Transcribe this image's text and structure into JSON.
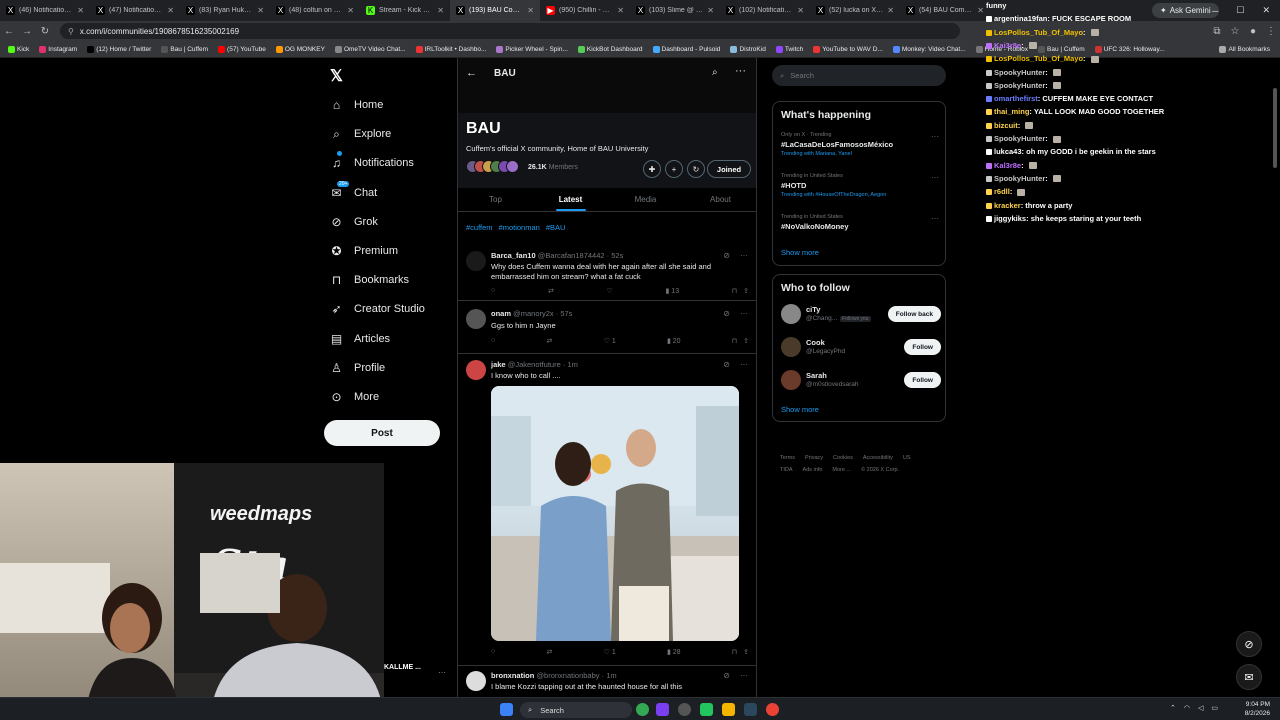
{
  "browser": {
    "tabs": [
      {
        "title": "(46) Notifications / X",
        "icon": "x-icon",
        "active": false
      },
      {
        "title": "(47) Notifications / X",
        "icon": "x-icon",
        "active": false
      },
      {
        "title": "(83) Ryan Hukery on",
        "icon": "x-icon",
        "active": false
      },
      {
        "title": "(48) coltun on X: \"ht",
        "icon": "x-icon",
        "active": false
      },
      {
        "title": "Stream - Kick Dashb",
        "icon": "kick-icon",
        "active": false
      },
      {
        "title": "(193) BAU Communi",
        "icon": "x-icon",
        "active": true
      },
      {
        "title": "(950) Chillin - YouTu",
        "icon": "youtube-icon",
        "active": false
      },
      {
        "title": "(103) Slime @ on X",
        "icon": "x-icon",
        "active": false
      },
      {
        "title": "(102) Notifications /",
        "icon": "x-icon",
        "active": false
      },
      {
        "title": "(52) lucka on X: \"htt",
        "icon": "x-icon",
        "active": false
      },
      {
        "title": "(54) BAU Commun",
        "icon": "x-icon",
        "active": false
      }
    ],
    "ask_gemini": "Ask Gemini",
    "url": "x.com/i/communities/1908678516235002169",
    "bookmarks": [
      "Kick",
      "Instagram",
      "(12) Home / Twitter",
      "Bau | Cuffem",
      "(57) YouTube",
      "OG MONKEY",
      "OmeTV Video Chat...",
      "IRLToolkit • Dashbo...",
      "Picker Wheel - Spin...",
      "KickBot Dashboard",
      "Dashboard - Pulsoid",
      "DistroKid",
      "Twitch",
      "YouTube to WAV D...",
      "Monkey: Video Chat...",
      "Home - Roblox",
      "Bau | Cuffem",
      "UFC 326: Holloway..."
    ],
    "all_bookmarks": "All Bookmarks"
  },
  "left_nav": {
    "items": [
      {
        "label": "Home",
        "icon": "home-icon"
      },
      {
        "label": "Explore",
        "icon": "search-icon"
      },
      {
        "label": "Notifications",
        "icon": "bell-icon"
      },
      {
        "label": "Chat",
        "icon": "chat-icon",
        "badge": "20+"
      },
      {
        "label": "Grok",
        "icon": "grok-icon"
      },
      {
        "label": "Premium",
        "icon": "premium-icon"
      },
      {
        "label": "Bookmarks",
        "icon": "bookmark-icon"
      },
      {
        "label": "Creator Studio",
        "icon": "rocket-icon"
      },
      {
        "label": "Articles",
        "icon": "article-icon"
      },
      {
        "label": "Profile",
        "icon": "profile-icon"
      },
      {
        "label": "More",
        "icon": "more-icon"
      }
    ],
    "post_button": "Post"
  },
  "community": {
    "header_title": "BAU",
    "title": "BAU",
    "description": "Cuffem's official X community, Home of BAU University",
    "members_count": "26.1K",
    "members_label": "Members",
    "joined_label": "Joined",
    "tabs": [
      "Top",
      "Latest",
      "Media",
      "About"
    ],
    "active_tab": "Latest",
    "tags": [
      "#cuffem",
      "#motionman",
      "#BAU"
    ]
  },
  "tweets": [
    {
      "name": "Barca_fan10",
      "handle": "@Barcafan1874442",
      "time": "52s",
      "text": "Why does Cuffem wanna deal with her again after all she said and embarrassed him on stream? what a fat cuck",
      "replies": "",
      "retweets": "",
      "likes": "",
      "views": "13"
    },
    {
      "name": "onam",
      "handle": "@manory2x",
      "time": "57s",
      "text": "Ggs to him n Jayne",
      "replies": "",
      "retweets": "",
      "likes": "1",
      "views": "20"
    },
    {
      "name": "jake",
      "handle": "@Jakenotfuture",
      "time": "1m",
      "text": "I know who to call ....",
      "replies": "",
      "retweets": "",
      "likes": "1",
      "views": "28"
    },
    {
      "name": "bronxnation",
      "handle": "@bronxnationbaby",
      "time": "1m",
      "text": "I blame Kozzi tapping out at the haunted house for all this",
      "replies": "",
      "retweets": "",
      "likes": "",
      "views": ""
    }
  ],
  "right": {
    "search_placeholder": "Search",
    "whats_happening": "What's happening",
    "trends": [
      {
        "context": "Only on X · Trending",
        "name": "#LaCasaDeLosFamososMéxico",
        "with_label": "Trending with",
        "with": "Mariana, Yanel"
      },
      {
        "context": "Trending in United States",
        "name": "#HOTD",
        "with_label": "Trending with",
        "with": "#HouseOfTheDragon, Aegon"
      },
      {
        "context": "Trending in United States",
        "name": "#NoValkoNoMoney",
        "with_label": "",
        "with": ""
      }
    ],
    "show_more": "Show more",
    "who_to_follow": "Who to follow",
    "follow": [
      {
        "name": "ciTy",
        "handle": "@Chang...",
        "follows_you": "Follows you",
        "button": "Follow back"
      },
      {
        "name": "Cook",
        "handle": "@LegacyPhd",
        "follows_you": "",
        "button": "Follow"
      },
      {
        "name": "Sarah",
        "handle": "@m0stlovedsarah",
        "follows_you": "",
        "button": "Follow"
      }
    ],
    "show_more_2": "Show more",
    "footer": [
      "Terms",
      "Privacy",
      "Cookies",
      "Accessibility",
      "US TIDA",
      "Ads info",
      "More ...",
      "© 2026 X Corp."
    ]
  },
  "chat": [
    {
      "user": "",
      "msg": "funny",
      "color": "#ffffff"
    },
    {
      "user": "argentina19fan",
      "msg": "FUCK ESCAPE ROOM",
      "color": "#ffffff"
    },
    {
      "user": "LosPollos_Tub_Of_Mayo",
      "msg": "",
      "color": "#f0c000"
    },
    {
      "user": "Kai3r8e",
      "msg": "",
      "color": "#c070ff"
    },
    {
      "user": "LosPollos_Tub_Of_Mayo",
      "msg": "",
      "color": "#f0c000"
    },
    {
      "user": "SpookyHunter",
      "msg": "",
      "color": "#c8c8c8"
    },
    {
      "user": "SpookyHunter",
      "msg": "",
      "color": "#c8c8c8"
    },
    {
      "user": "omarthefirst",
      "msg": "CUFFEM MAKE EYE CONTACT",
      "color": "#6a7dff"
    },
    {
      "user": "thai_ming",
      "msg": "YALL LOOK MAD GOOD TOGETHER",
      "color": "#ffd34d"
    },
    {
      "user": "bizcuit",
      "msg": "",
      "color": "#ffd34d"
    },
    {
      "user": "SpookyHunter",
      "msg": "",
      "color": "#c8c8c8"
    },
    {
      "user": "lukca43",
      "msg": "oh my GODD i be geekin in the stars",
      "color": "#ffffff"
    },
    {
      "user": "Kal3r8e",
      "msg": "",
      "color": "#c070ff"
    },
    {
      "user": "SpookyHunter",
      "msg": "",
      "color": "#c8c8c8"
    },
    {
      "user": "r6dll",
      "msg": "",
      "color": "#ffd34d"
    },
    {
      "user": "kracker",
      "msg": "throw a party",
      "color": "#ffd34d"
    },
    {
      "user": "jiggykiks",
      "msg": "she keeps staring at your teeth",
      "color": "#ffffff"
    }
  ],
  "stream": {
    "banner_text_1": "weedmaps",
    "banner_text_2": "Sta",
    "streamer_name": "KALLME ..."
  },
  "taskbar": {
    "search": "Search",
    "time": "9:04 PM",
    "date": "8/2/2026"
  },
  "colors": {
    "accent": "#1d9bf0",
    "background": "#000000",
    "border": "#2f3336",
    "muted": "#71767b"
  }
}
